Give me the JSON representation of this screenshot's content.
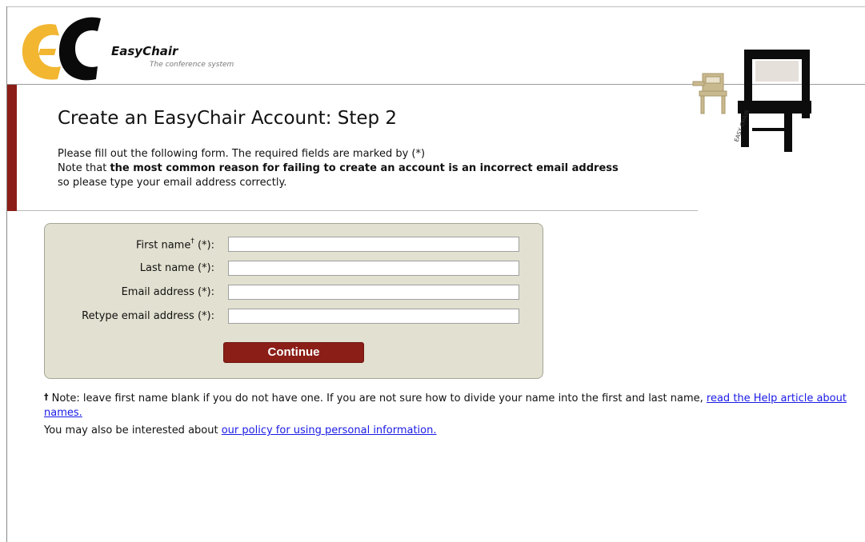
{
  "brand": {
    "name": "EasyChair",
    "tagline": "The conference system",
    "chair_text": "EASY CHAIR",
    "colors": {
      "accent": "#8b1e17",
      "logo_yellow": "#f2b631",
      "logo_black": "#0a0a0a",
      "panel": "#e2e0d0",
      "link": "#1a1ae6"
    }
  },
  "page": {
    "title": "Create an EasyChair Account: Step 2",
    "intro_line1": "Please fill out the following form. The required fields are marked by (*)",
    "intro_line2_prefix": "Note that ",
    "intro_line2_bold": "the most common reason for failing to create an account is an incorrect email address",
    "intro_line3": "so please type your email address correctly."
  },
  "form": {
    "fields": [
      {
        "label": "First name",
        "sup": "†",
        "required_mark": " (*):",
        "value": "",
        "placeholder": ""
      },
      {
        "label": "Last name",
        "required_mark": " (*):",
        "value": "",
        "placeholder": ""
      },
      {
        "label": "Email address",
        "required_mark": " (*):",
        "value": "",
        "placeholder": ""
      },
      {
        "label": "Retype email address",
        "required_mark": " (*):",
        "value": "",
        "placeholder": ""
      }
    ],
    "submit_label": "Continue"
  },
  "notes": {
    "dagger": "†",
    "name_note_text": " Note: leave first name blank if you do not have one. If you are not sure how to divide your name into the first and last name, ",
    "name_note_link": "read the Help article about names.",
    "policy_text": "You may also be interested about ",
    "policy_link": "our policy for using personal information."
  }
}
